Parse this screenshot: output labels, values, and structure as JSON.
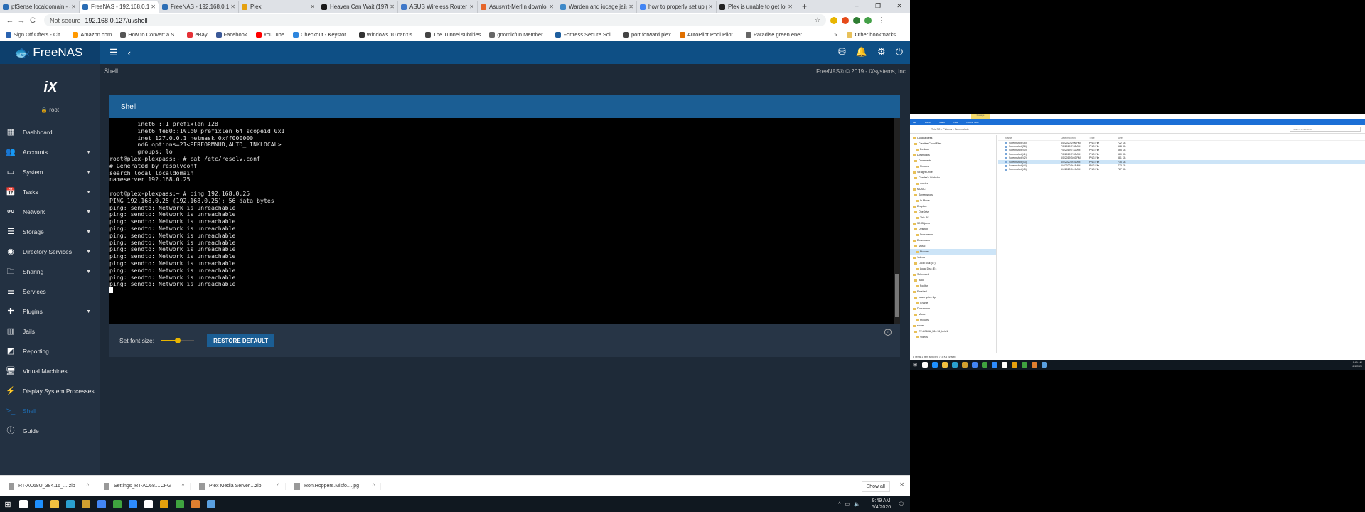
{
  "browser": {
    "tabs": [
      {
        "title": "pfSense.localdomain - St",
        "color": "#2b6db5"
      },
      {
        "title": "FreeNAS - 192.168.0.127",
        "color": "#2b6db5",
        "active": true
      },
      {
        "title": "FreeNAS - 192.168.0.165",
        "color": "#2b6db5"
      },
      {
        "title": "Plex",
        "color": "#e5a00d"
      },
      {
        "title": "Heaven Can Wait (1978)",
        "color": "#1a1a1a"
      },
      {
        "title": "ASUS Wireless Router RT",
        "color": "#3f78c9"
      },
      {
        "title": "Asuswrt-Merlin downloa",
        "color": "#e6662a"
      },
      {
        "title": "Warden and iocage jails",
        "color": "#3f8ac9"
      },
      {
        "title": "how to properly set up p",
        "color": "#4285f4"
      },
      {
        "title": "Plex is unable to get loca",
        "color": "#222222"
      }
    ],
    "new_tab": "+",
    "window_controls": [
      "–",
      "❐",
      "✕"
    ],
    "back": "←",
    "forward": "→",
    "reload": "C",
    "not_secure": "Not secure",
    "url": "192.168.0.127/ui/shell",
    "star": "☆",
    "menu": "⋮",
    "bookmarks": [
      {
        "label": "Sign Off Offers - Cit...",
        "color": "#2a63b0"
      },
      {
        "label": "Amazon.com",
        "color": "#ff9900"
      },
      {
        "label": "How to Convert a S...",
        "color": "#555555"
      },
      {
        "label": "eBay",
        "color": "#e53238"
      },
      {
        "label": "Facebook",
        "color": "#3b5998"
      },
      {
        "label": "YouTube",
        "color": "#ff0000"
      },
      {
        "label": "Checkout - Keystor...",
        "color": "#2e86de"
      },
      {
        "label": "Windows 10 can't s...",
        "color": "#333333"
      },
      {
        "label": "The Tunnel subtitles",
        "color": "#444444"
      },
      {
        "label": "gnomicfun Member...",
        "color": "#666666"
      },
      {
        "label": "Fortress Secure Sol...",
        "color": "#1f5f9f"
      },
      {
        "label": "port forward plex",
        "color": "#444444"
      },
      {
        "label": "AutoPilot Pool Pilot...",
        "color": "#e07000"
      },
      {
        "label": "Paradise green ener...",
        "color": "#666666"
      }
    ],
    "bookmarks_more": "»",
    "other_bookmarks": "Other bookmarks"
  },
  "app": {
    "logo_text": "FreeNAS",
    "page_title": "Shell",
    "copyright": "FreeNAS® © 2019 - iXsystems, Inc.",
    "ix_logo": "iX",
    "user": "root",
    "accent": "#0e4f85"
  },
  "nav": [
    {
      "label": "Dashboard",
      "icon": "dashboard-icon",
      "glyph": "▦",
      "chevron": false
    },
    {
      "label": "Accounts",
      "icon": "accounts-icon",
      "glyph": "👥",
      "chevron": true
    },
    {
      "label": "System",
      "icon": "system-icon",
      "glyph": "▭",
      "chevron": true
    },
    {
      "label": "Tasks",
      "icon": "tasks-icon",
      "glyph": "📅",
      "chevron": true
    },
    {
      "label": "Network",
      "icon": "network-icon",
      "glyph": "⚯",
      "chevron": true
    },
    {
      "label": "Storage",
      "icon": "storage-icon",
      "glyph": "☰",
      "chevron": true
    },
    {
      "label": "Directory Services",
      "icon": "directory-services-icon",
      "glyph": "◉",
      "chevron": true
    },
    {
      "label": "Sharing",
      "icon": "sharing-icon",
      "glyph": "🗀",
      "chevron": true
    },
    {
      "label": "Services",
      "icon": "services-icon",
      "glyph": "⚌",
      "chevron": false
    },
    {
      "label": "Plugins",
      "icon": "plugins-icon",
      "glyph": "✚",
      "chevron": true
    },
    {
      "label": "Jails",
      "icon": "jails-icon",
      "glyph": "▥",
      "chevron": false
    },
    {
      "label": "Reporting",
      "icon": "reporting-icon",
      "glyph": "◩",
      "chevron": false
    },
    {
      "label": "Virtual Machines",
      "icon": "virtual-machines-icon",
      "glyph": "🖥",
      "chevron": false
    },
    {
      "label": "Display System Processes",
      "icon": "processes-icon",
      "glyph": "⚡",
      "chevron": false
    },
    {
      "label": "Shell",
      "icon": "shell-icon",
      "glyph": ">_",
      "chevron": false,
      "active": true
    },
    {
      "label": "Guide",
      "icon": "guide-icon",
      "glyph": "ⓘ",
      "chevron": false
    }
  ],
  "shell": {
    "title": "Shell",
    "lines": [
      "        inet6 ::1 prefixlen 128",
      "        inet6 fe80::1%lo0 prefixlen 64 scopeid 0x1",
      "        inet 127.0.0.1 netmask 0xff000000",
      "        nd6 options=21<PERFORMNUD,AUTO_LINKLOCAL>",
      "        groups: lo",
      "root@plex-plexpass:~ # cat /etc/resolv.conf",
      "# Generated by resolvconf",
      "search local localdomain",
      "nameserver 192.168.0.25",
      "",
      "root@plex-plexpass:~ # ping 192.168.0.25",
      "PING 192.168.0.25 (192.168.0.25): 56 data bytes",
      "ping: sendto: Network is unreachable",
      "ping: sendto: Network is unreachable",
      "ping: sendto: Network is unreachable",
      "ping: sendto: Network is unreachable",
      "ping: sendto: Network is unreachable",
      "ping: sendto: Network is unreachable",
      "ping: sendto: Network is unreachable",
      "ping: sendto: Network is unreachable",
      "ping: sendto: Network is unreachable",
      "ping: sendto: Network is unreachable",
      "ping: sendto: Network is unreachable",
      "ping: sendto: Network is unreachable"
    ],
    "font_size_label": "Set font size:",
    "font_size_level": 0.5,
    "restore_default": "RESTORE DEFAULT",
    "help": "?"
  },
  "downloads": {
    "items": [
      "RT-AC68U_384.16_....zip",
      "Settings_RT-AC68....CFG",
      "Plex Media Server....zip",
      "Ron.Hoppers.Misfo....jpg"
    ],
    "show_all": "Show all",
    "close": "✕"
  },
  "taskbar": {
    "apps": [
      "#ffffff",
      "#1e90ff",
      "#f0c040",
      "#2aa0d0",
      "#d0a030",
      "#4285f4",
      "#3fa33f",
      "#2d8cff",
      "#ffffff",
      "#e5a00d",
      "#3fa33f",
      "#e08030",
      "#5aa0e0"
    ],
    "time": "9:49 AM",
    "date": "6/4/2020"
  },
  "explorer": {
    "title_tab": "Manage",
    "ribbon": [
      "File",
      "Home",
      "Share",
      "View",
      "Picture Tools"
    ],
    "path": "This PC  >  Pictures  >  Screenshots",
    "search": "Search Screenshots",
    "tree": [
      {
        "label": "Quick access",
        "sel": false
      },
      {
        "label": "Creative Cloud Files",
        "sel": false
      },
      {
        "label": "Desktop",
        "sel": false
      },
      {
        "label": "Downloads",
        "sel": false
      },
      {
        "label": "Documents",
        "sel": false
      },
      {
        "label": "Pictures",
        "sel": false
      },
      {
        "label": "Straight Drive",
        "sel": false
      },
      {
        "label": "Charles's Worksho",
        "sel": false
      },
      {
        "label": "movies",
        "sel": false
      },
      {
        "label": "MUSIC",
        "sel": false
      },
      {
        "label": "Screenshots",
        "sel": false
      },
      {
        "label": "In Movie",
        "sel": false
      },
      {
        "label": "Dropbox",
        "sel": false
      },
      {
        "label": "OneDrive",
        "sel": false
      },
      {
        "label": "This PC",
        "sel": false
      },
      {
        "label": "3D Objects",
        "sel": false
      },
      {
        "label": "Desktop",
        "sel": false
      },
      {
        "label": "Documents",
        "sel": false
      },
      {
        "label": "Downloads",
        "sel": false
      },
      {
        "label": "Music",
        "sel": false
      },
      {
        "label": "Pictures",
        "sel": true
      },
      {
        "label": "Videos",
        "sel": false
      },
      {
        "label": "Local Disk (C:)",
        "sel": false
      },
      {
        "label": "Local Disk (E:)",
        "sel": false
      },
      {
        "label": "Scheduled",
        "sel": false
      },
      {
        "label": "Bock",
        "sel": false
      },
      {
        "label": "Fooltur",
        "sel": false
      },
      {
        "label": "Finished",
        "sel": false
      },
      {
        "label": "haarb quick flip",
        "sel": false
      },
      {
        "label": "Charlie",
        "sel": false
      },
      {
        "label": "Documents",
        "sel": false
      },
      {
        "label": "Music",
        "sel": false
      },
      {
        "label": "Pictures",
        "sel": false
      },
      {
        "label": "router",
        "sel": false
      },
      {
        "label": "RT-AC68U_384.16_beta1",
        "sel": false
      },
      {
        "label": "Videos",
        "sel": false
      }
    ],
    "columns": [
      "Name",
      "Date modified",
      "Type",
      "Size"
    ],
    "files": [
      {
        "name": "Screenshot (35)",
        "date": "6/1/2020 2:06 PM",
        "type": "PNG File",
        "size": "722 KB",
        "sel": false
      },
      {
        "name": "Screenshot (36)",
        "date": "7/1/2019 7:32 AM",
        "type": "PNG File",
        "size": "668 KB",
        "sel": false
      },
      {
        "name": "Screenshot (40)",
        "date": "7/1/2019 7:32 AM",
        "type": "PNG File",
        "size": "665 KB",
        "sel": false
      },
      {
        "name": "Screenshot (41)",
        "date": "7/1/2019 7:33 AM",
        "type": "PNG File",
        "size": "580 KB",
        "sel": false
      },
      {
        "name": "Screenshot (42)",
        "date": "6/1/2019 3:02 PM",
        "type": "PNG File",
        "size": "581 KB",
        "sel": false
      },
      {
        "name": "Screenshot (43)",
        "date": "6/4/2020 9:46 AM",
        "type": "PNG File",
        "size": "715 KB",
        "sel": true
      },
      {
        "name": "Screenshot (44)",
        "date": "6/4/2020 9:48 AM",
        "type": "PNG File",
        "size": "723 KB",
        "sel": false
      },
      {
        "name": "Screenshot (45)",
        "date": "6/4/2020 9:49 AM",
        "type": "PNG File",
        "size": "727 KB",
        "sel": false
      }
    ],
    "status": "8 items   1 item selected 715 KB   Shared",
    "time": "9:49 AM",
    "date": "6/4/2020"
  }
}
